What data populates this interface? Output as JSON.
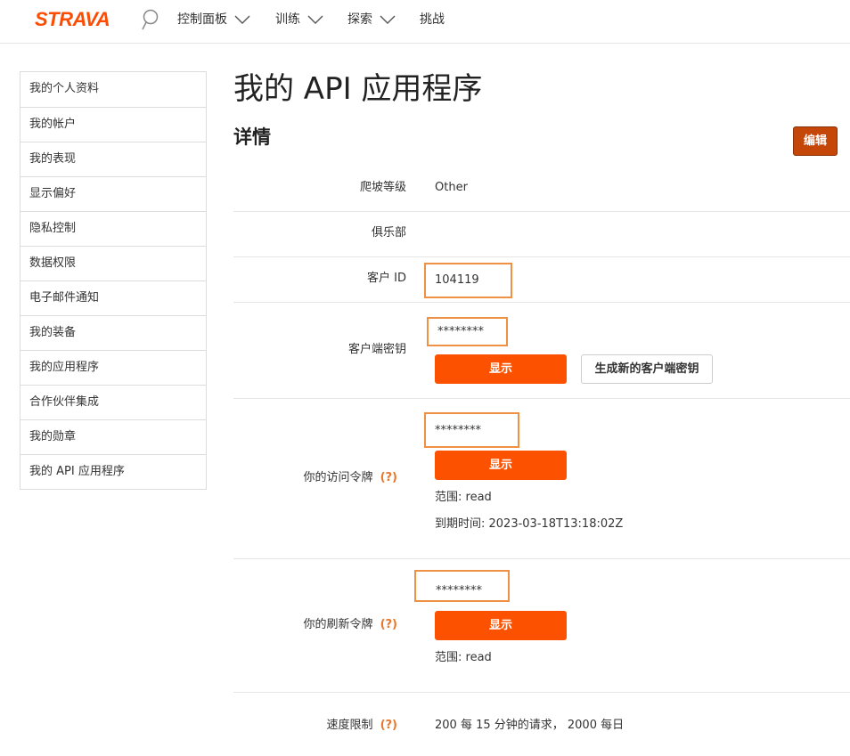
{
  "brand": {
    "logo_text": "STRAVA",
    "color": "#fc4c02"
  },
  "nav": {
    "search_icon": "search-icon",
    "items": [
      {
        "label": "控制面板",
        "has_dropdown": true
      },
      {
        "label": "训练",
        "has_dropdown": true
      },
      {
        "label": "探索",
        "has_dropdown": true
      },
      {
        "label": "挑战",
        "has_dropdown": false
      }
    ]
  },
  "sidebar": {
    "items": [
      {
        "label": "我的个人资料"
      },
      {
        "label": "我的帐户"
      },
      {
        "label": "我的表现"
      },
      {
        "label": "显示偏好"
      },
      {
        "label": "隐私控制"
      },
      {
        "label": "数据权限"
      },
      {
        "label": "电子邮件通知"
      },
      {
        "label": "我的装备"
      },
      {
        "label": "我的应用程序"
      },
      {
        "label": "合作伙伴集成"
      },
      {
        "label": "我的勋章"
      },
      {
        "label": "我的 API 应用程序"
      }
    ]
  },
  "main": {
    "title": "我的 API 应用程序",
    "section_title": "详情",
    "edit_label": "编辑",
    "rows": {
      "climb": {
        "label": "爬坡等级",
        "value": "Other"
      },
      "club": {
        "label": "俱乐部",
        "value": ""
      },
      "client_id": {
        "label": "客户 ID",
        "value": "104119"
      },
      "client_secret": {
        "label": "客户端密钥",
        "masked": "********",
        "show_label": "显示",
        "generate_label": "生成新的客户端密钥"
      },
      "access_token": {
        "label": "你的访问令牌",
        "help": "(?)",
        "masked": "********",
        "show_label": "显示",
        "scope": "范围: read",
        "expires": "到期时间: 2023-03-18T13:18:02Z"
      },
      "refresh_token": {
        "label": "你的刷新令牌",
        "help": "(?)",
        "masked": "********",
        "show_label": "显示",
        "scope": "范围: read"
      },
      "rate_limit": {
        "label": "速度限制",
        "help": "(?)",
        "value": "200 每 15 分钟的请求， 2000 每日"
      }
    }
  },
  "colors": {
    "accent": "#fc5200",
    "highlight": "#ef9145",
    "edit": "#c44608"
  }
}
